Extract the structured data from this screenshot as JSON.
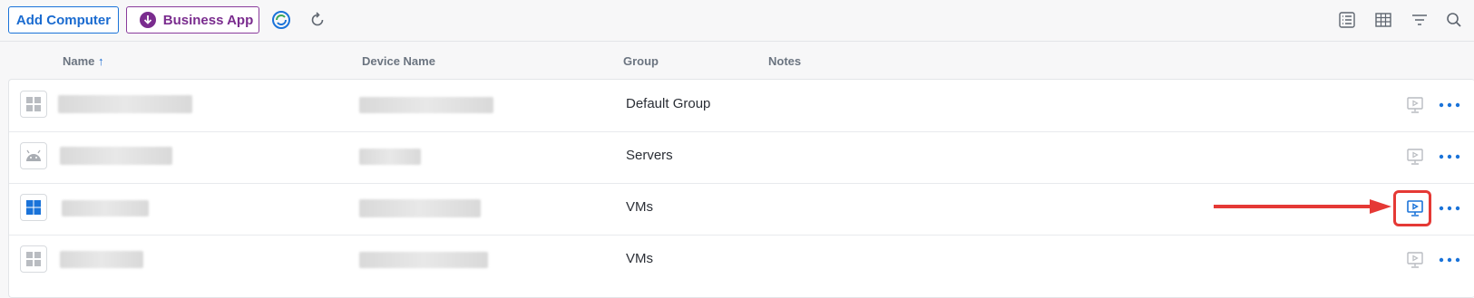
{
  "toolbar": {
    "add_computer_label": "Add Computer",
    "business_app_label": "Business App",
    "icons": [
      "sync-logo-icon",
      "refresh-icon",
      "list-view-icon",
      "grid-view-icon",
      "filter-icon",
      "search-icon"
    ]
  },
  "table": {
    "columns": {
      "name": "Name",
      "sort_indicator": "↑",
      "device_name": "Device Name",
      "group": "Group",
      "notes": "Notes"
    },
    "rows": [
      {
        "os": "generic-windows",
        "group": "Default Group",
        "remote_active": false
      },
      {
        "os": "android",
        "group": "Servers",
        "remote_active": false
      },
      {
        "os": "windows",
        "group": "VMs",
        "remote_active": true
      },
      {
        "os": "generic-windows",
        "group": "VMs",
        "remote_active": false
      }
    ]
  },
  "colors": {
    "accent_blue": "#1a6bd0",
    "business_purple": "#7a2c8e",
    "highlight_red": "#e53935"
  }
}
